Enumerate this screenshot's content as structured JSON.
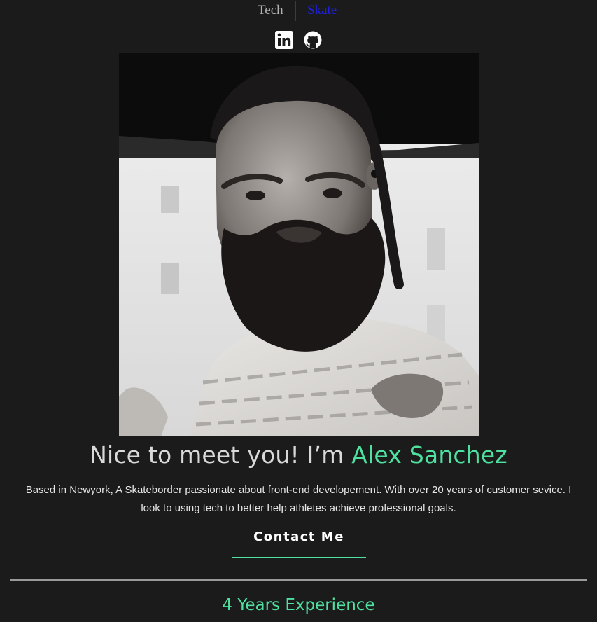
{
  "nav": {
    "links": [
      {
        "label": "Tech"
      },
      {
        "label": "Skate"
      }
    ]
  },
  "social": {
    "icons": [
      "linkedin-icon",
      "github-icon"
    ]
  },
  "hero": {
    "greeting": "Nice to meet you! I’m ",
    "name": "Alex Sanchez",
    "bio": "Based in Newyork, A Skateborder passionate about front-end developement. With over 20 years of customer sevice. I look to using tech to better help athletes achieve professional goals.",
    "contact_label": "Contact Me"
  },
  "experience": {
    "label": "4 Years Experience"
  },
  "colors": {
    "background": "#1b1b1b",
    "accent": "#4ee1a0",
    "text": "#d9d9d9",
    "link_visited": "#b3b3b3",
    "link": "#1f22e0"
  }
}
